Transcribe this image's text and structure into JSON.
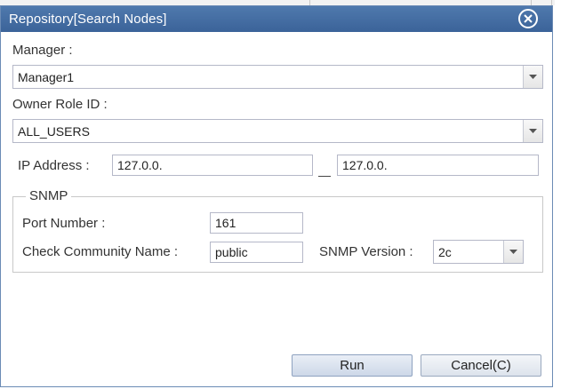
{
  "dialog": {
    "title": "Repository[Search Nodes]",
    "close_icon": "close-circle-icon"
  },
  "form": {
    "manager": {
      "label": "Manager :",
      "value": "Manager1"
    },
    "owner_role": {
      "label": "Owner Role ID :",
      "value": "ALL_USERS"
    },
    "ip_address": {
      "label": "IP Address :",
      "from": "127.0.0.",
      "to": "127.0.0."
    },
    "snmp": {
      "legend": "SNMP",
      "port_label": "Port Number :",
      "port_value": "161",
      "community_label": "Check Community Name :",
      "community_value": "public",
      "version_label": "SNMP Version :",
      "version_value": "2c"
    }
  },
  "buttons": {
    "run": "Run",
    "cancel": "Cancel(C)"
  },
  "colors": {
    "titlebar": "#3f689e",
    "border": "#b5b8c8"
  }
}
